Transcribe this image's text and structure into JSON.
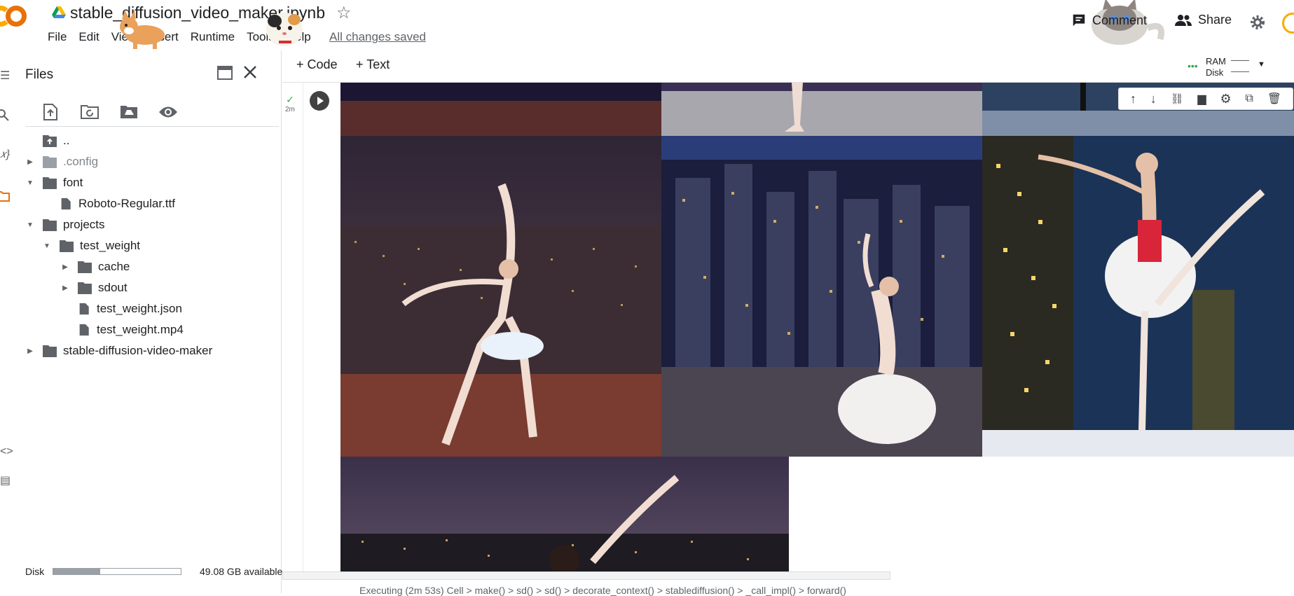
{
  "header": {
    "notebook_title": "stable_diffusion_video_maker.ipynb",
    "menu": [
      "File",
      "Edit",
      "View",
      "Insert",
      "Runtime",
      "Tools",
      "Help"
    ],
    "saved_status": "All changes saved",
    "comment_label": "Comment",
    "share_label": "Share"
  },
  "files_panel": {
    "title": "Files",
    "tree": [
      {
        "label": "..",
        "type": "parent"
      },
      {
        "label": ".config",
        "type": "folder",
        "collapsed": true
      },
      {
        "label": "font",
        "type": "folder",
        "expanded": true
      },
      {
        "label": "Roboto-Regular.ttf",
        "type": "file"
      },
      {
        "label": "projects",
        "type": "folder",
        "expanded": true
      },
      {
        "label": "test_weight",
        "type": "folder",
        "expanded": true
      },
      {
        "label": "cache",
        "type": "folder",
        "collapsed": true
      },
      {
        "label": "sdout",
        "type": "folder",
        "collapsed": true
      },
      {
        "label": "test_weight.json",
        "type": "file"
      },
      {
        "label": "test_weight.mp4",
        "type": "file"
      },
      {
        "label": "stable-diffusion-video-maker",
        "type": "folder",
        "collapsed": true
      }
    ],
    "disk": {
      "label": "Disk",
      "used_fraction": 0.37,
      "available": "49.08 GB available"
    }
  },
  "notebook": {
    "add_code_label": "Code",
    "add_text_label": "Text",
    "ram_label": "RAM",
    "disk_label": "Disk",
    "cell_exec_time": "2m",
    "status_bar": "Executing (2m 53s)  Cell > make() > sd() > sd() > decorate_context() > stablediffusion() > _call_impl() > forward()"
  },
  "colors": {
    "accent_orange": "#f9ab00",
    "accent_dark_orange": "#e8710a",
    "folder_gray": "#5f6368",
    "ram_green": "#34a853"
  },
  "icons": [
    "menu-icon",
    "search-icon",
    "variables-icon",
    "folder-icon",
    "upload-icon",
    "refresh-icon",
    "drive-icon",
    "eye-icon",
    "comment-icon",
    "share-icon",
    "gear-icon",
    "star-icon",
    "run-icon",
    "close-icon",
    "maximize-icon"
  ]
}
